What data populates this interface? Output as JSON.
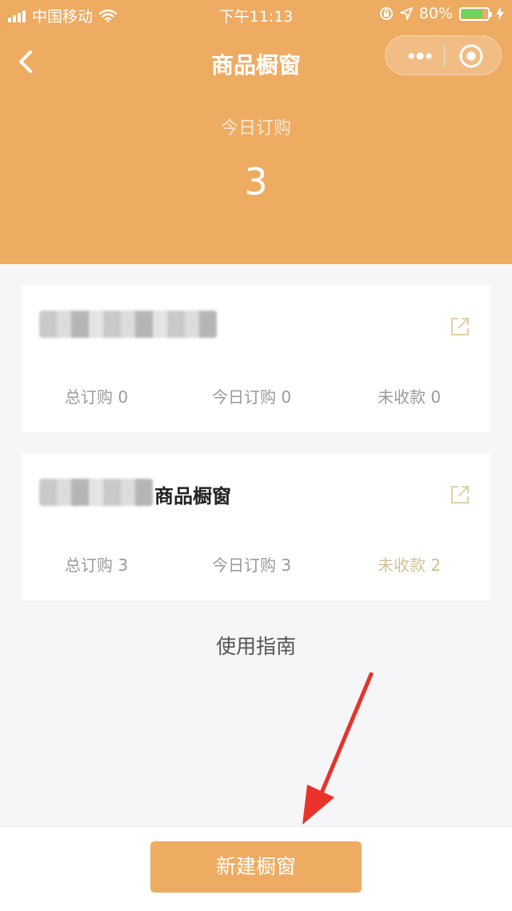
{
  "status_bar": {
    "carrier": "中国移动",
    "time": "下午11:13",
    "battery": "80%",
    "battery_level": 0.8
  },
  "nav": {
    "title": "商品橱窗"
  },
  "summary": {
    "today_label": "今日订购",
    "today_count": "3"
  },
  "cards": [
    {
      "name": "",
      "stats": [
        "总订购 0",
        "今日订购 0",
        "未收款 0"
      ]
    },
    {
      "name": "商品橱窗",
      "stats": [
        "总订购 3",
        "今日订购 3",
        "未收款 2"
      ]
    }
  ],
  "guide_link": "使用指南",
  "footer": {
    "new_button": "新建橱窗"
  },
  "colors": {
    "accent": "#eeab62",
    "unpaid_highlight": "#d2c196",
    "arrow": "#e8322a"
  }
}
